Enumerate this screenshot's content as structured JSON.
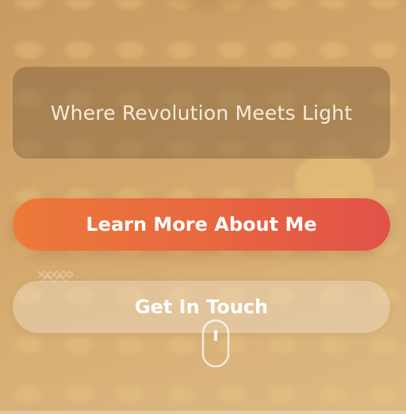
{
  "tagline": "Where Revolution Meets Light",
  "buttons": {
    "primary_label": "Learn More About Me",
    "secondary_label": "Get In Touch"
  },
  "icons": {
    "scroll": "mouse-scroll-icon",
    "decoration": "crosshatch-decoration-icon"
  },
  "colors": {
    "primary_start": "#ec7a3a",
    "primary_end": "#e25149",
    "background": "#d4a86c"
  }
}
